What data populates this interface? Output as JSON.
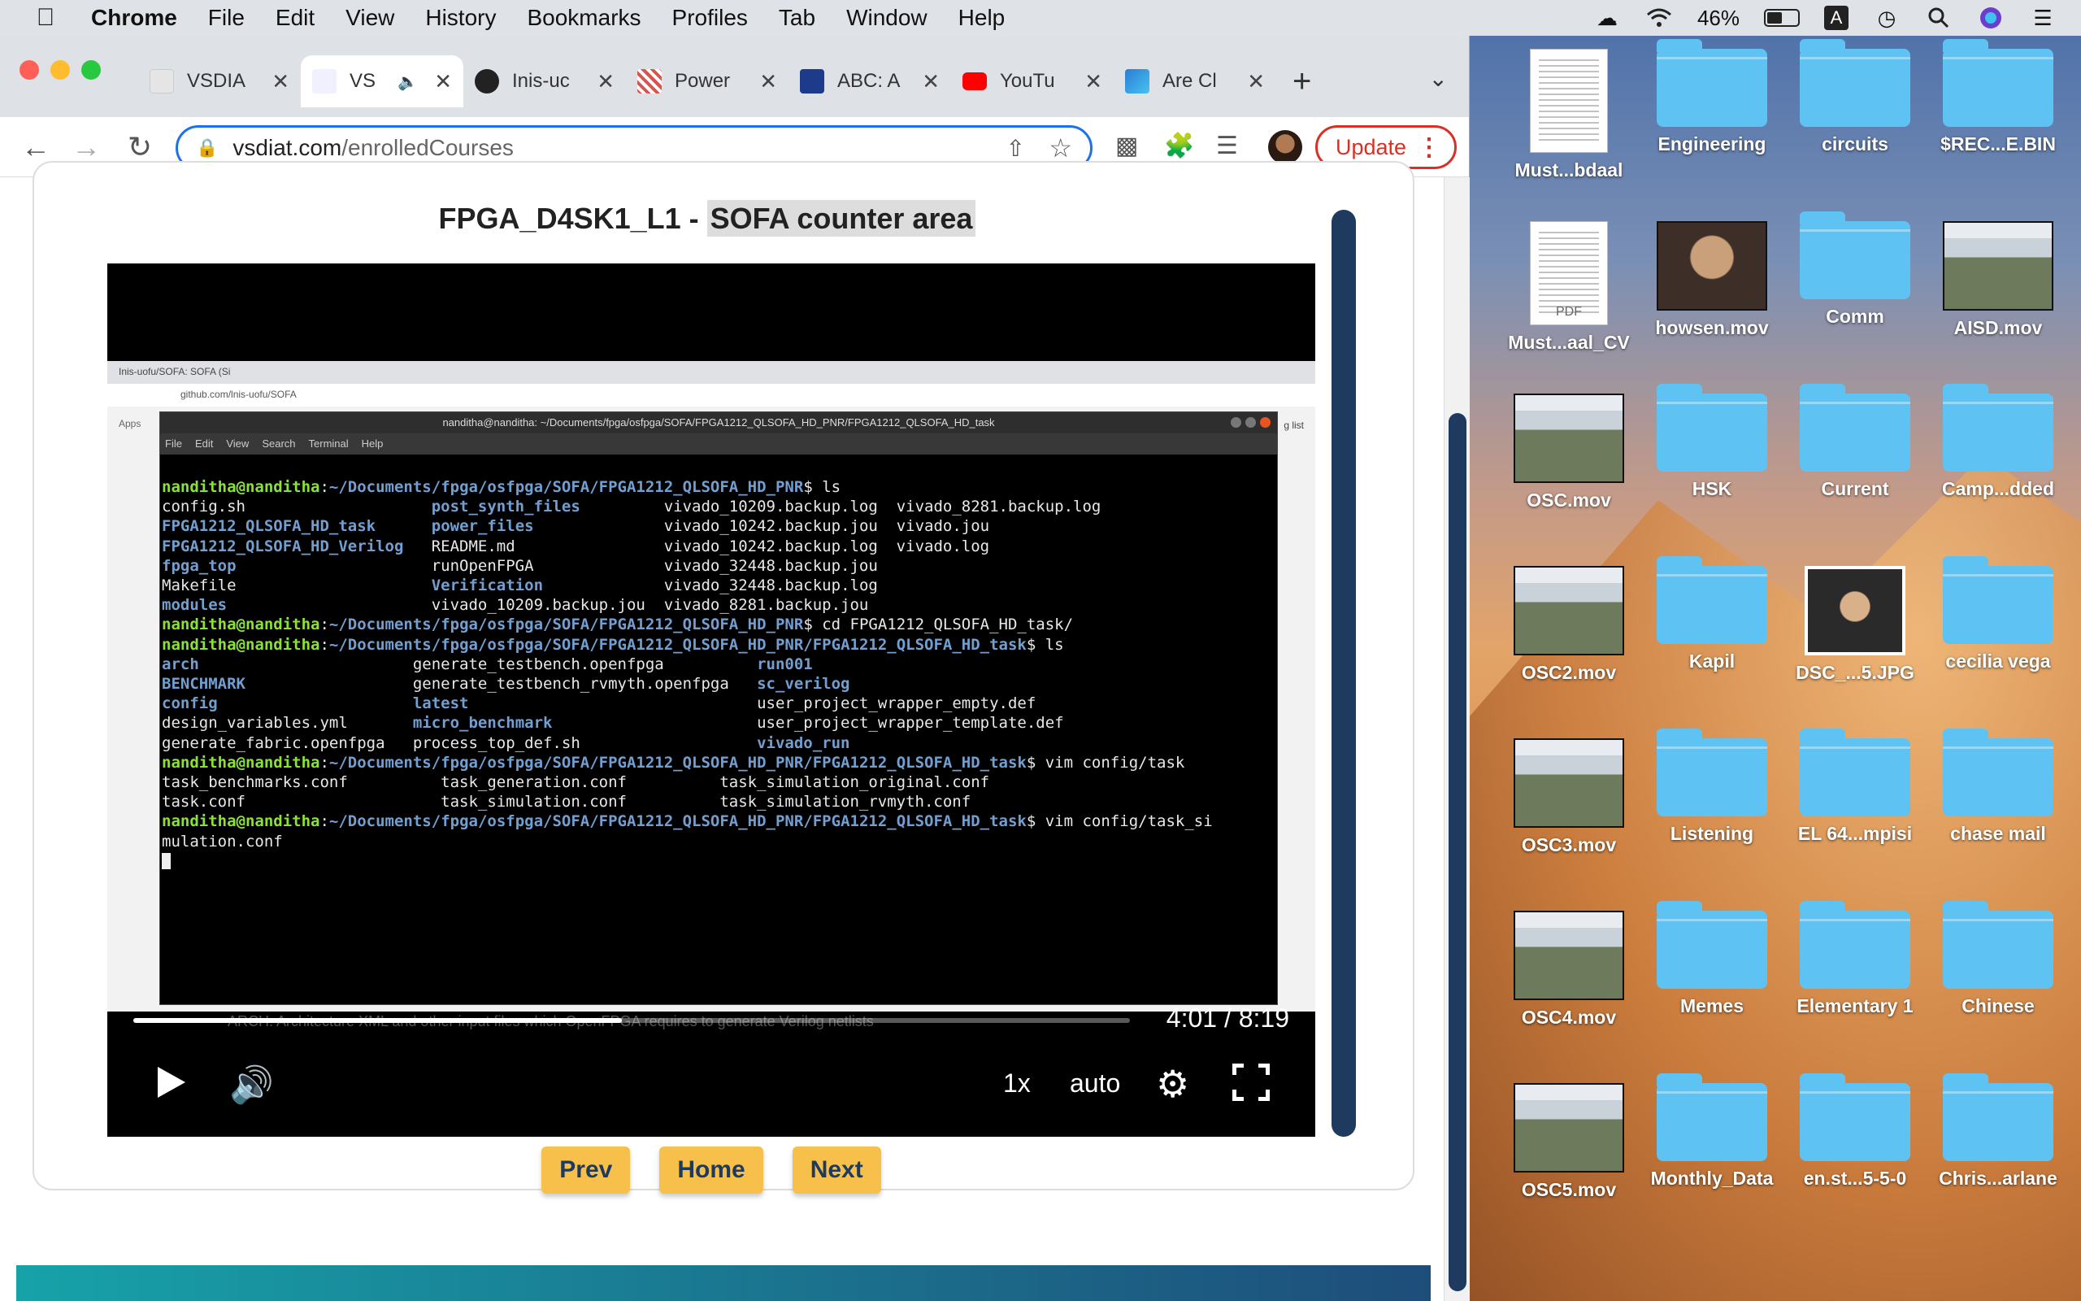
{
  "menubar": {
    "app": "Chrome",
    "items": [
      "File",
      "Edit",
      "View",
      "History",
      "Bookmarks",
      "Profiles",
      "Tab",
      "Window",
      "Help"
    ],
    "battery": "46%"
  },
  "tabs": [
    {
      "label": "VSDIA",
      "active": false,
      "color": "#dddddd"
    },
    {
      "label": "VS",
      "active": true,
      "color": "#ffffff"
    },
    {
      "label": "Inis-uc",
      "active": false,
      "color": "#222222"
    },
    {
      "label": "Power",
      "active": false,
      "color": "#d9534f"
    },
    {
      "label": "ABC: A",
      "active": false,
      "color": "#1e3a8a"
    },
    {
      "label": "YouTu",
      "active": false,
      "color": "#ff0000"
    },
    {
      "label": "Are Cl",
      "active": false,
      "color": "#2b7cd3"
    }
  ],
  "omnibox": {
    "host": "vsdiat.com",
    "path": "/enrolledCourses"
  },
  "update_label": "Update",
  "lesson": {
    "prefix": "FPGA_D4SK1_L1 - ",
    "highlight": "SOFA counter area"
  },
  "inner_browser": {
    "tab": "Inis-uofu/SOFA: SOFA (Si",
    "url": "github.com/lnis-uofu/SOFA",
    "apps": "Apps",
    "list": "g list",
    "below_text": "ARCH: Architecture XML and other input files which OpenFPGA requires to generate Verilog netlists"
  },
  "terminal": {
    "title": "nanditha@nanditha: ~/Documents/fpga/osfpga/SOFA/FPGA1212_QLSOFA_HD_PNR/FPGA1212_QLSOFA_HD_task",
    "menu": [
      "File",
      "Edit",
      "View",
      "Search",
      "Terminal",
      "Help"
    ]
  },
  "video": {
    "time": "4:01 / 8:19",
    "progress": 0.49,
    "speed": "1x",
    "quality": "auto"
  },
  "nav": {
    "prev": "Prev",
    "home": "Home",
    "next": "Next"
  },
  "desktop_icons": [
    {
      "label": "Must...bdaal",
      "kind": "doc"
    },
    {
      "label": "Engineering",
      "kind": "folder"
    },
    {
      "label": "circuits",
      "kind": "folder"
    },
    {
      "label": "$REC...E.BIN",
      "kind": "folder"
    },
    {
      "label": "Must...aal_CV",
      "kind": "pdf"
    },
    {
      "label": "howsen.mov",
      "kind": "person"
    },
    {
      "label": "Comm",
      "kind": "folder"
    },
    {
      "label": "AISD.mov",
      "kind": "video"
    },
    {
      "label": "OSC.mov",
      "kind": "video"
    },
    {
      "label": "HSK",
      "kind": "folder"
    },
    {
      "label": "Current",
      "kind": "folder"
    },
    {
      "label": "Camp...dded",
      "kind": "folder"
    },
    {
      "label": "OSC2.mov",
      "kind": "video"
    },
    {
      "label": "Kapil",
      "kind": "folder"
    },
    {
      "label": "DSC_...5.JPG",
      "kind": "photo"
    },
    {
      "label": "cecilia vega",
      "kind": "folder"
    },
    {
      "label": "OSC3.mov",
      "kind": "video"
    },
    {
      "label": "Listening",
      "kind": "folder"
    },
    {
      "label": "EL 64...mpisi",
      "kind": "folder"
    },
    {
      "label": "chase mail",
      "kind": "folder"
    },
    {
      "label": "OSC4.mov",
      "kind": "video"
    },
    {
      "label": "Memes",
      "kind": "folder"
    },
    {
      "label": "Elementary 1",
      "kind": "folder"
    },
    {
      "label": "Chinese",
      "kind": "folder"
    },
    {
      "label": "OSC5.mov",
      "kind": "video"
    },
    {
      "label": "Monthly_Data",
      "kind": "folder"
    },
    {
      "label": "en.st...5-5-0",
      "kind": "folder"
    },
    {
      "label": "Chris...arlane",
      "kind": "folder"
    }
  ],
  "pdf_badge": "PDF"
}
